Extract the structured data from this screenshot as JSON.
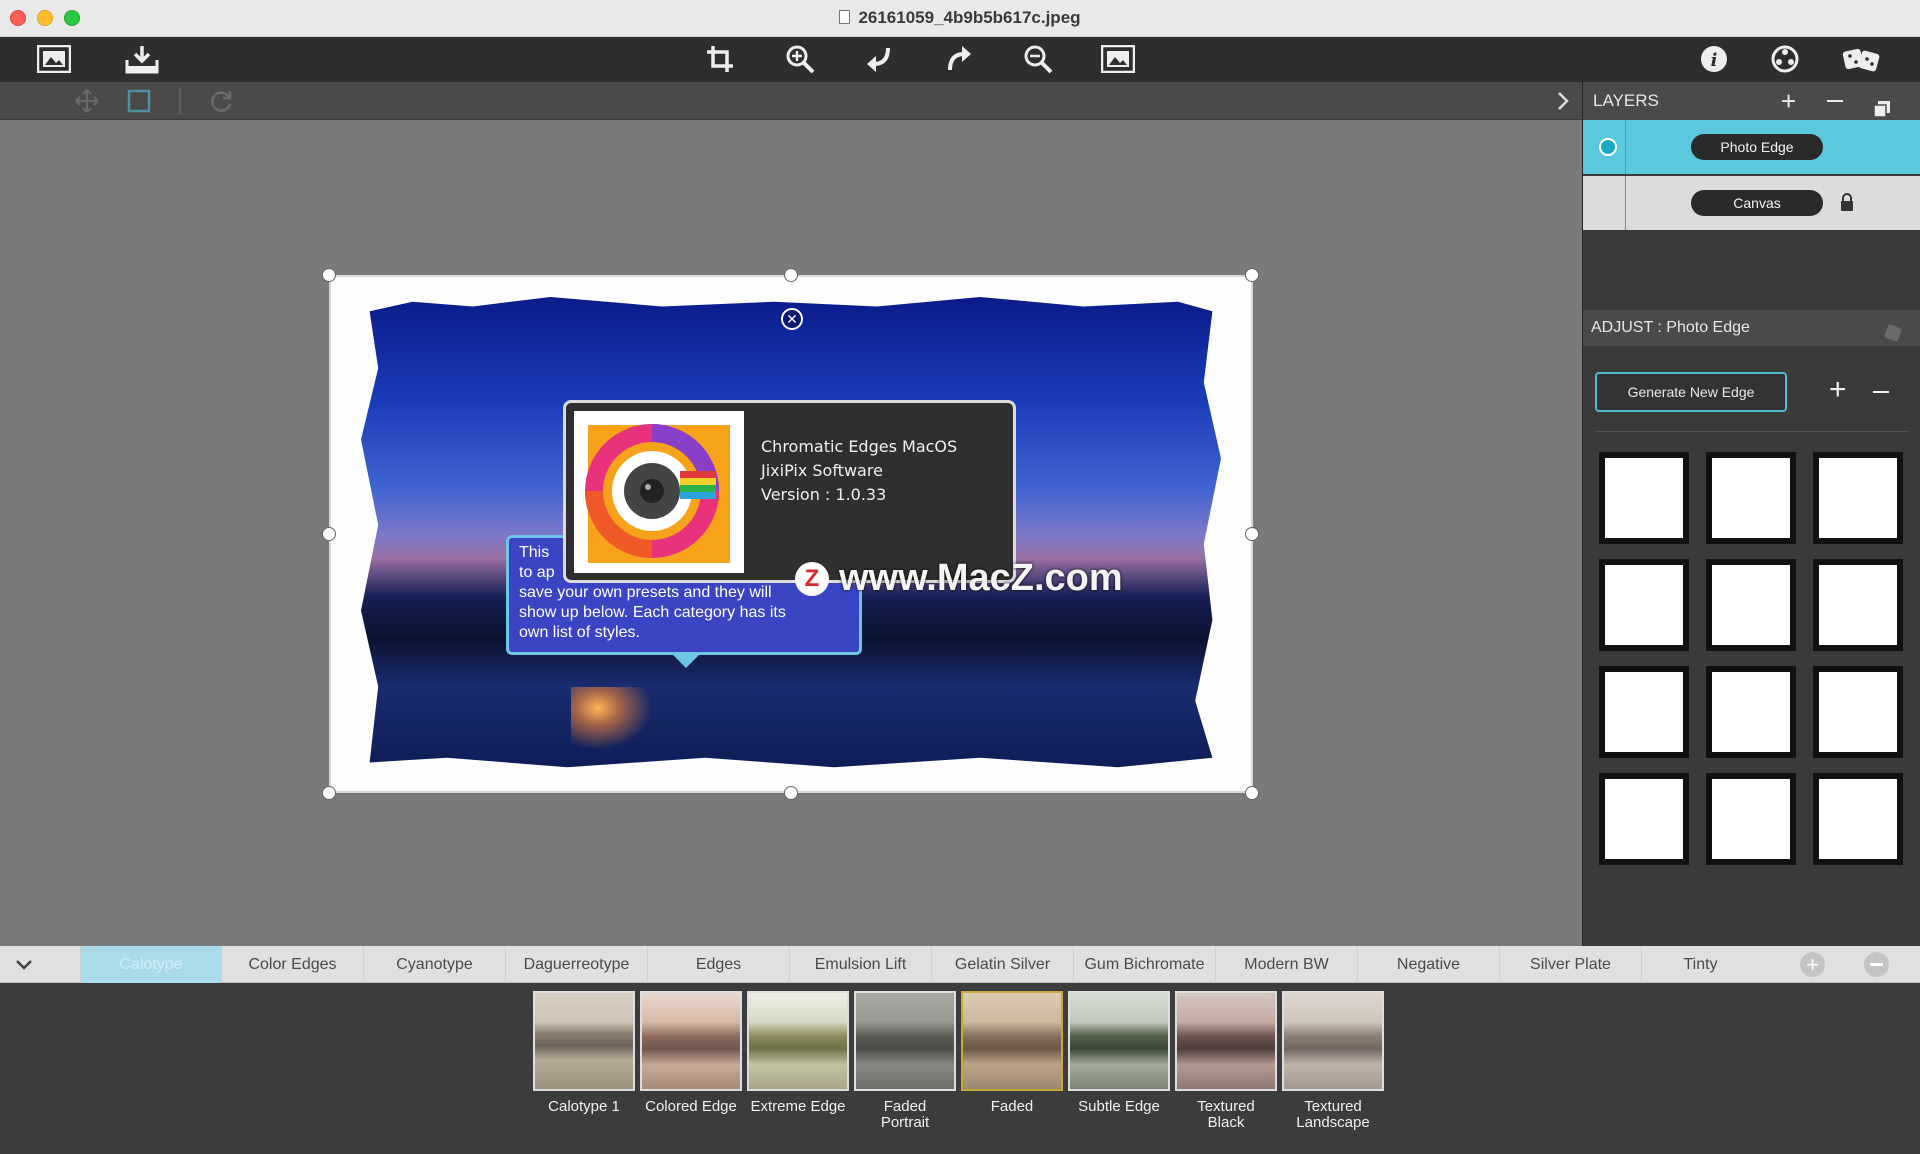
{
  "window": {
    "title": "26161059_4b9b5b617c.jpeg"
  },
  "about": {
    "line1": "Chromatic Edges MacOS",
    "line2": "JixiPix Software",
    "line3": "Version : 1.0.33"
  },
  "tooltip": {
    "line1": "This",
    "line2": "to ap",
    "line3": "save your own presets and they will",
    "line4": "show up below. Each category has its",
    "line5": "own list of styles."
  },
  "watermark": {
    "badge": "Z",
    "text": "www.MacZ.com"
  },
  "layers": {
    "header": "LAYERS",
    "items": [
      {
        "label": "Photo Edge",
        "selected": true
      },
      {
        "label": "Canvas",
        "locked": true
      }
    ]
  },
  "adjust": {
    "header": "ADJUST : Photo Edge",
    "generate_label": "Generate New Edge"
  },
  "tabs": [
    {
      "label": "Calotype",
      "active": true
    },
    {
      "label": "Color Edges"
    },
    {
      "label": "Cyanotype"
    },
    {
      "label": "Daguerreotype"
    },
    {
      "label": "Edges"
    },
    {
      "label": "Emulsion Lift"
    },
    {
      "label": "Gelatin Silver"
    },
    {
      "label": "Gum Bichromate"
    },
    {
      "label": "Modern BW"
    },
    {
      "label": "Negative"
    },
    {
      "label": "Silver Plate"
    },
    {
      "label": "Tinty"
    }
  ],
  "presets": [
    {
      "line1": "Calotype 1",
      "line2": ""
    },
    {
      "line1": "Colored Edge",
      "line2": ""
    },
    {
      "line1": "Extreme Edge",
      "line2": ""
    },
    {
      "line1": "Faded",
      "line2": "Portrait"
    },
    {
      "line1": "Faded",
      "line2": ""
    },
    {
      "line1": "Subtle Edge",
      "line2": ""
    },
    {
      "line1": "Textured",
      "line2": "Black"
    },
    {
      "line1": "Textured",
      "line2": "Landscape"
    }
  ],
  "colors": {
    "accent": "#4fb8d2",
    "selected_layer": "#5bc8dd",
    "active_tab": "#a9dbe9"
  }
}
